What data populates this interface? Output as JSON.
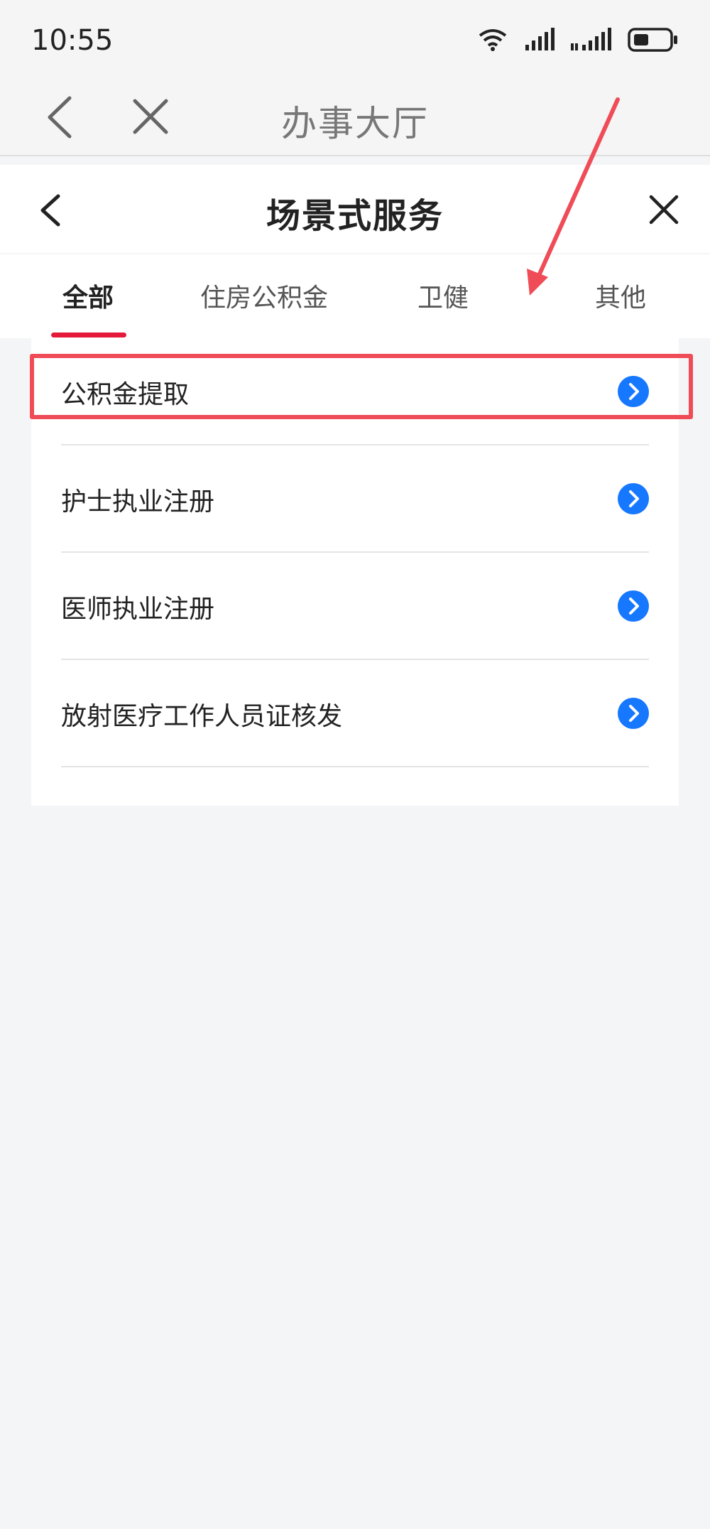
{
  "status_bar": {
    "time": "10:55",
    "icons": [
      "wifi-icon",
      "signal-icon",
      "signal-icon",
      "battery-icon"
    ]
  },
  "outer_header": {
    "title": "办事大厅",
    "back_icon": "back-arrow-icon",
    "close_icon": "close-icon"
  },
  "inner_header": {
    "title": "场景式服务",
    "back_icon": "back-arrow-icon",
    "close_icon": "close-icon"
  },
  "tabs": [
    {
      "label": "全部",
      "active": true
    },
    {
      "label": "住房公积金",
      "active": false
    },
    {
      "label": "卫健",
      "active": false
    },
    {
      "label": "其他",
      "active": false
    }
  ],
  "services": [
    {
      "label": "公积金提取",
      "icon": "chevron-right-circle-icon"
    },
    {
      "label": "护士执业注册",
      "icon": "chevron-right-circle-icon"
    },
    {
      "label": "医师执业注册",
      "icon": "chevron-right-circle-icon"
    },
    {
      "label": "放射医疗工作人员证核发",
      "icon": "chevron-right-circle-icon"
    }
  ],
  "colors": {
    "accent": "#e5193a",
    "arrow_button": "#1677ff",
    "annotation": "#ef4c57",
    "background": "#f4f5f7"
  }
}
